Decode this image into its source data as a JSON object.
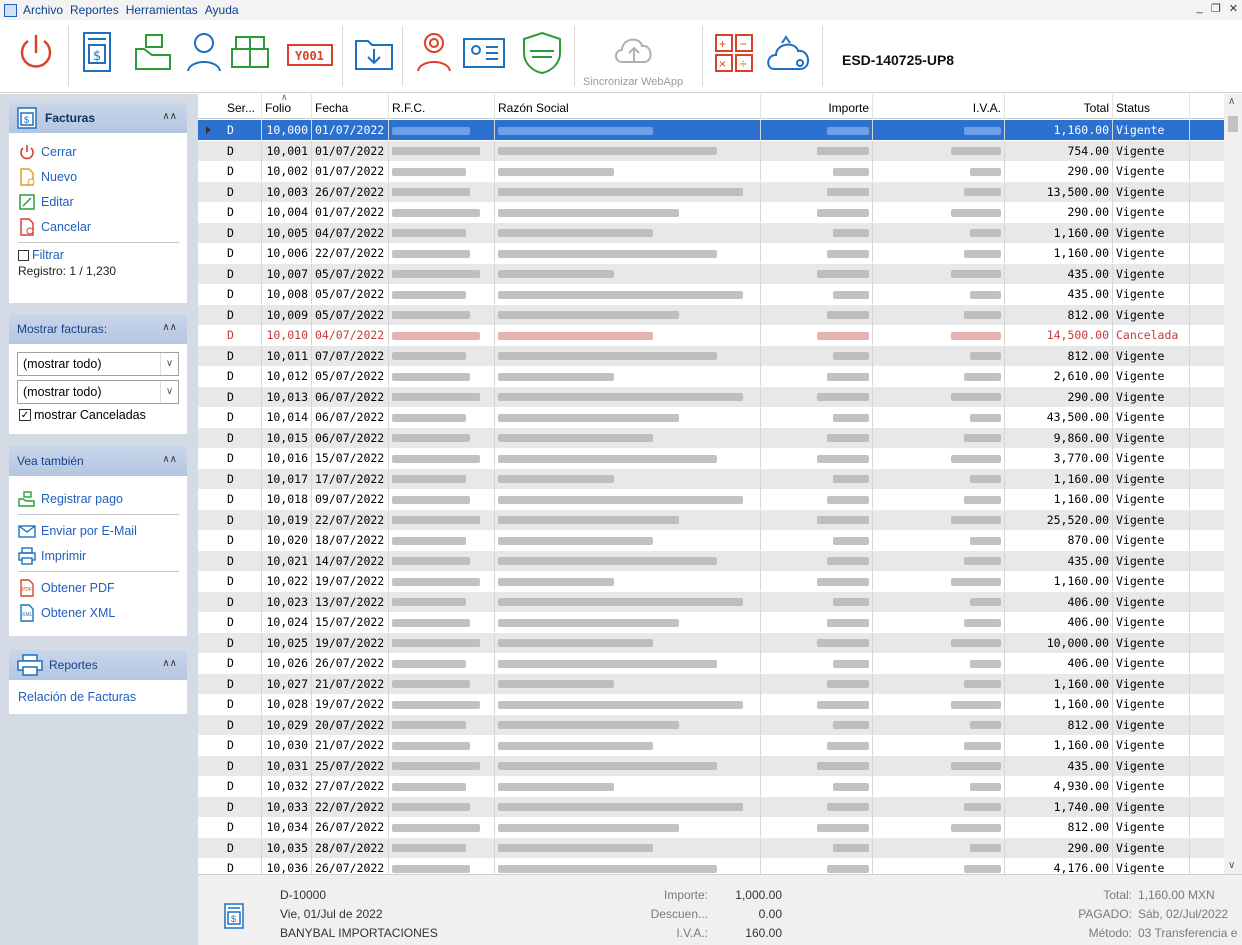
{
  "menu": {
    "items": [
      "Archivo",
      "Reportes",
      "Herramientas",
      "Ayuda"
    ]
  },
  "toolbar": {
    "sync_label": "Sincronizar WebApp",
    "rfc": "ESD-140725-UP8",
    "invoice_code": "Y001"
  },
  "sidebar": {
    "facturas": {
      "title": "Facturas",
      "links": [
        "Cerrar",
        "Nuevo",
        "Editar",
        "Cancelar"
      ],
      "filter_label": "Filtrar",
      "registro": "Registro: 1 / 1,230"
    },
    "mostrar": {
      "title": "Mostrar facturas:",
      "select1": "(mostrar todo)",
      "select2": "(mostrar todo)",
      "show_cancelled": "mostrar Canceladas"
    },
    "vea": {
      "title": "Vea también",
      "links": [
        "Registrar pago",
        "Enviar por E-Mail",
        "Imprimir",
        "Obtener PDF",
        "Obtener XML"
      ]
    },
    "reportes": {
      "title": "Reportes",
      "links": [
        "Relación de Facturas"
      ]
    }
  },
  "grid": {
    "columns": [
      "Ser...",
      "Folio",
      "Fecha",
      "R.F.C.",
      "Razón Social",
      "Importe",
      "I.V.A.",
      "Total",
      "Status"
    ],
    "rows": [
      {
        "serie": "D",
        "folio": "10,000",
        "fecha": "01/07/2022",
        "total": "1,160.00",
        "status": "Vigente"
      },
      {
        "serie": "D",
        "folio": "10,001",
        "fecha": "01/07/2022",
        "total": "754.00",
        "status": "Vigente"
      },
      {
        "serie": "D",
        "folio": "10,002",
        "fecha": "01/07/2022",
        "total": "290.00",
        "status": "Vigente"
      },
      {
        "serie": "D",
        "folio": "10,003",
        "fecha": "26/07/2022",
        "total": "13,500.00",
        "status": "Vigente"
      },
      {
        "serie": "D",
        "folio": "10,004",
        "fecha": "01/07/2022",
        "total": "290.00",
        "status": "Vigente"
      },
      {
        "serie": "D",
        "folio": "10,005",
        "fecha": "04/07/2022",
        "total": "1,160.00",
        "status": "Vigente"
      },
      {
        "serie": "D",
        "folio": "10,006",
        "fecha": "22/07/2022",
        "total": "1,160.00",
        "status": "Vigente"
      },
      {
        "serie": "D",
        "folio": "10,007",
        "fecha": "05/07/2022",
        "total": "435.00",
        "status": "Vigente"
      },
      {
        "serie": "D",
        "folio": "10,008",
        "fecha": "05/07/2022",
        "total": "435.00",
        "status": "Vigente"
      },
      {
        "serie": "D",
        "folio": "10,009",
        "fecha": "05/07/2022",
        "total": "812.00",
        "status": "Vigente"
      },
      {
        "serie": "D",
        "folio": "10,010",
        "fecha": "04/07/2022",
        "total": "14,500.00",
        "status": "Cancelada"
      },
      {
        "serie": "D",
        "folio": "10,011",
        "fecha": "07/07/2022",
        "total": "812.00",
        "status": "Vigente"
      },
      {
        "serie": "D",
        "folio": "10,012",
        "fecha": "05/07/2022",
        "total": "2,610.00",
        "status": "Vigente"
      },
      {
        "serie": "D",
        "folio": "10,013",
        "fecha": "06/07/2022",
        "total": "290.00",
        "status": "Vigente"
      },
      {
        "serie": "D",
        "folio": "10,014",
        "fecha": "06/07/2022",
        "total": "43,500.00",
        "status": "Vigente"
      },
      {
        "serie": "D",
        "folio": "10,015",
        "fecha": "06/07/2022",
        "total": "9,860.00",
        "status": "Vigente"
      },
      {
        "serie": "D",
        "folio": "10,016",
        "fecha": "15/07/2022",
        "total": "3,770.00",
        "status": "Vigente"
      },
      {
        "serie": "D",
        "folio": "10,017",
        "fecha": "17/07/2022",
        "total": "1,160.00",
        "status": "Vigente"
      },
      {
        "serie": "D",
        "folio": "10,018",
        "fecha": "09/07/2022",
        "total": "1,160.00",
        "status": "Vigente"
      },
      {
        "serie": "D",
        "folio": "10,019",
        "fecha": "22/07/2022",
        "total": "25,520.00",
        "status": "Vigente"
      },
      {
        "serie": "D",
        "folio": "10,020",
        "fecha": "18/07/2022",
        "total": "870.00",
        "status": "Vigente"
      },
      {
        "serie": "D",
        "folio": "10,021",
        "fecha": "14/07/2022",
        "total": "435.00",
        "status": "Vigente"
      },
      {
        "serie": "D",
        "folio": "10,022",
        "fecha": "19/07/2022",
        "total": "1,160.00",
        "status": "Vigente"
      },
      {
        "serie": "D",
        "folio": "10,023",
        "fecha": "13/07/2022",
        "total": "406.00",
        "status": "Vigente"
      },
      {
        "serie": "D",
        "folio": "10,024",
        "fecha": "15/07/2022",
        "total": "406.00",
        "status": "Vigente"
      },
      {
        "serie": "D",
        "folio": "10,025",
        "fecha": "19/07/2022",
        "total": "10,000.00",
        "status": "Vigente"
      },
      {
        "serie": "D",
        "folio": "10,026",
        "fecha": "26/07/2022",
        "total": "406.00",
        "status": "Vigente"
      },
      {
        "serie": "D",
        "folio": "10,027",
        "fecha": "21/07/2022",
        "total": "1,160.00",
        "status": "Vigente"
      },
      {
        "serie": "D",
        "folio": "10,028",
        "fecha": "19/07/2022",
        "total": "1,160.00",
        "status": "Vigente"
      },
      {
        "serie": "D",
        "folio": "10,029",
        "fecha": "20/07/2022",
        "total": "812.00",
        "status": "Vigente"
      },
      {
        "serie": "D",
        "folio": "10,030",
        "fecha": "21/07/2022",
        "total": "1,160.00",
        "status": "Vigente"
      },
      {
        "serie": "D",
        "folio": "10,031",
        "fecha": "25/07/2022",
        "total": "435.00",
        "status": "Vigente"
      },
      {
        "serie": "D",
        "folio": "10,032",
        "fecha": "27/07/2022",
        "total": "4,930.00",
        "status": "Vigente"
      },
      {
        "serie": "D",
        "folio": "10,033",
        "fecha": "22/07/2022",
        "total": "1,740.00",
        "status": "Vigente"
      },
      {
        "serie": "D",
        "folio": "10,034",
        "fecha": "26/07/2022",
        "total": "812.00",
        "status": "Vigente"
      },
      {
        "serie": "D",
        "folio": "10,035",
        "fecha": "28/07/2022",
        "total": "290.00",
        "status": "Vigente"
      },
      {
        "serie": "D",
        "folio": "10,036",
        "fecha": "26/07/2022",
        "total": "4,176.00",
        "status": "Vigente"
      }
    ]
  },
  "footer": {
    "doc": "D-10000",
    "date": "Vie, 01/Jul de 2022",
    "client": "BANYBAL IMPORTACIONES",
    "importe_label": "Importe:",
    "importe": "1,000.00",
    "descuento_label": "Descuen...",
    "descuento": "0.00",
    "iva_label": "I.V.A.:",
    "iva": "160.00",
    "total_label": "Total:",
    "total": "1,160.00  MXN",
    "pagado_label": "PAGADO:",
    "pagado": "Sáb, 02/Jul/2022",
    "metodo_label": "Método:",
    "metodo": "03 Transferencia e"
  },
  "colors": {
    "accent_red": "#d9412b",
    "accent_green": "#2e9b3a",
    "accent_blue": "#1f6fbf",
    "selection": "#2b72d0",
    "cancel": "#c43b3b"
  }
}
